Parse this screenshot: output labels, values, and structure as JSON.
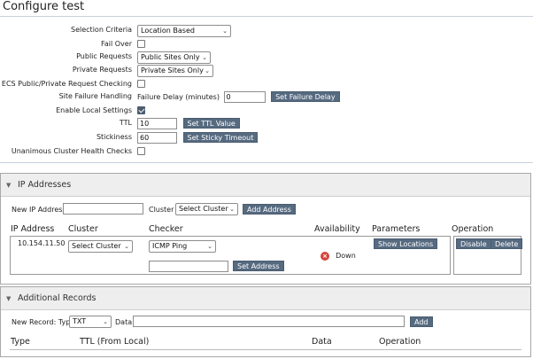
{
  "page": {
    "title": "Configure test"
  },
  "form": {
    "selection_criteria": {
      "label": "Selection Criteria",
      "value": "Location Based"
    },
    "fail_over": {
      "label": "Fail Over",
      "checked": false
    },
    "public_requests": {
      "label": "Public Requests",
      "value": "Public Sites Only"
    },
    "private_requests": {
      "label": "Private Requests",
      "value": "Private Sites Only"
    },
    "ecs_checking": {
      "label": "ECS Public/Private Request Checking",
      "checked": false
    },
    "site_failure": {
      "label": "Site Failure Handling",
      "inline_label": "Failure Delay (minutes)",
      "value": "0",
      "button": "Set Failure Delay"
    },
    "enable_local": {
      "label": "Enable Local Settings",
      "checked": true
    },
    "ttl": {
      "label": "TTL",
      "value": "10",
      "button": "Set TTL Value"
    },
    "stickiness": {
      "label": "Stickiness",
      "value": "60",
      "button": "Set Sticky Timeout"
    },
    "unanimous": {
      "label": "Unanimous Cluster Health Checks",
      "checked": false
    }
  },
  "ip_section": {
    "title": "IP Addresses",
    "new_ip_label": "New IP Address",
    "new_ip_value": "",
    "cluster_label": "Cluster",
    "cluster_select": "Select Cluster",
    "add_button": "Add Address",
    "columns": [
      "IP Address",
      "Cluster",
      "Checker",
      "Availability",
      "Parameters",
      "Operation"
    ],
    "row": {
      "ip": "10.154.11.50",
      "cluster": "Select Cluster",
      "checker": "ICMP Ping",
      "checker_address": "",
      "set_address_button": "Set Address",
      "availability": "Down",
      "parameters_button": "Show Locations",
      "disable_button": "Disable",
      "delete_button": "Delete"
    }
  },
  "records_section": {
    "title": "Additional Records",
    "new_record_label": "New Record: Type",
    "type_value": "TXT",
    "data_label": "Data",
    "data_value": "",
    "add_button": "Add",
    "columns": [
      "Type",
      "TTL (From Local)",
      "Data",
      "Operation"
    ]
  },
  "icons": {
    "dropdown": "chevron-down-icon",
    "collapse": "triangle-down-icon",
    "status_down": "x-circle-icon"
  },
  "colors": {
    "button": "#566a80",
    "status_down": "#d5443c",
    "panel_header": "#eeeeee"
  }
}
